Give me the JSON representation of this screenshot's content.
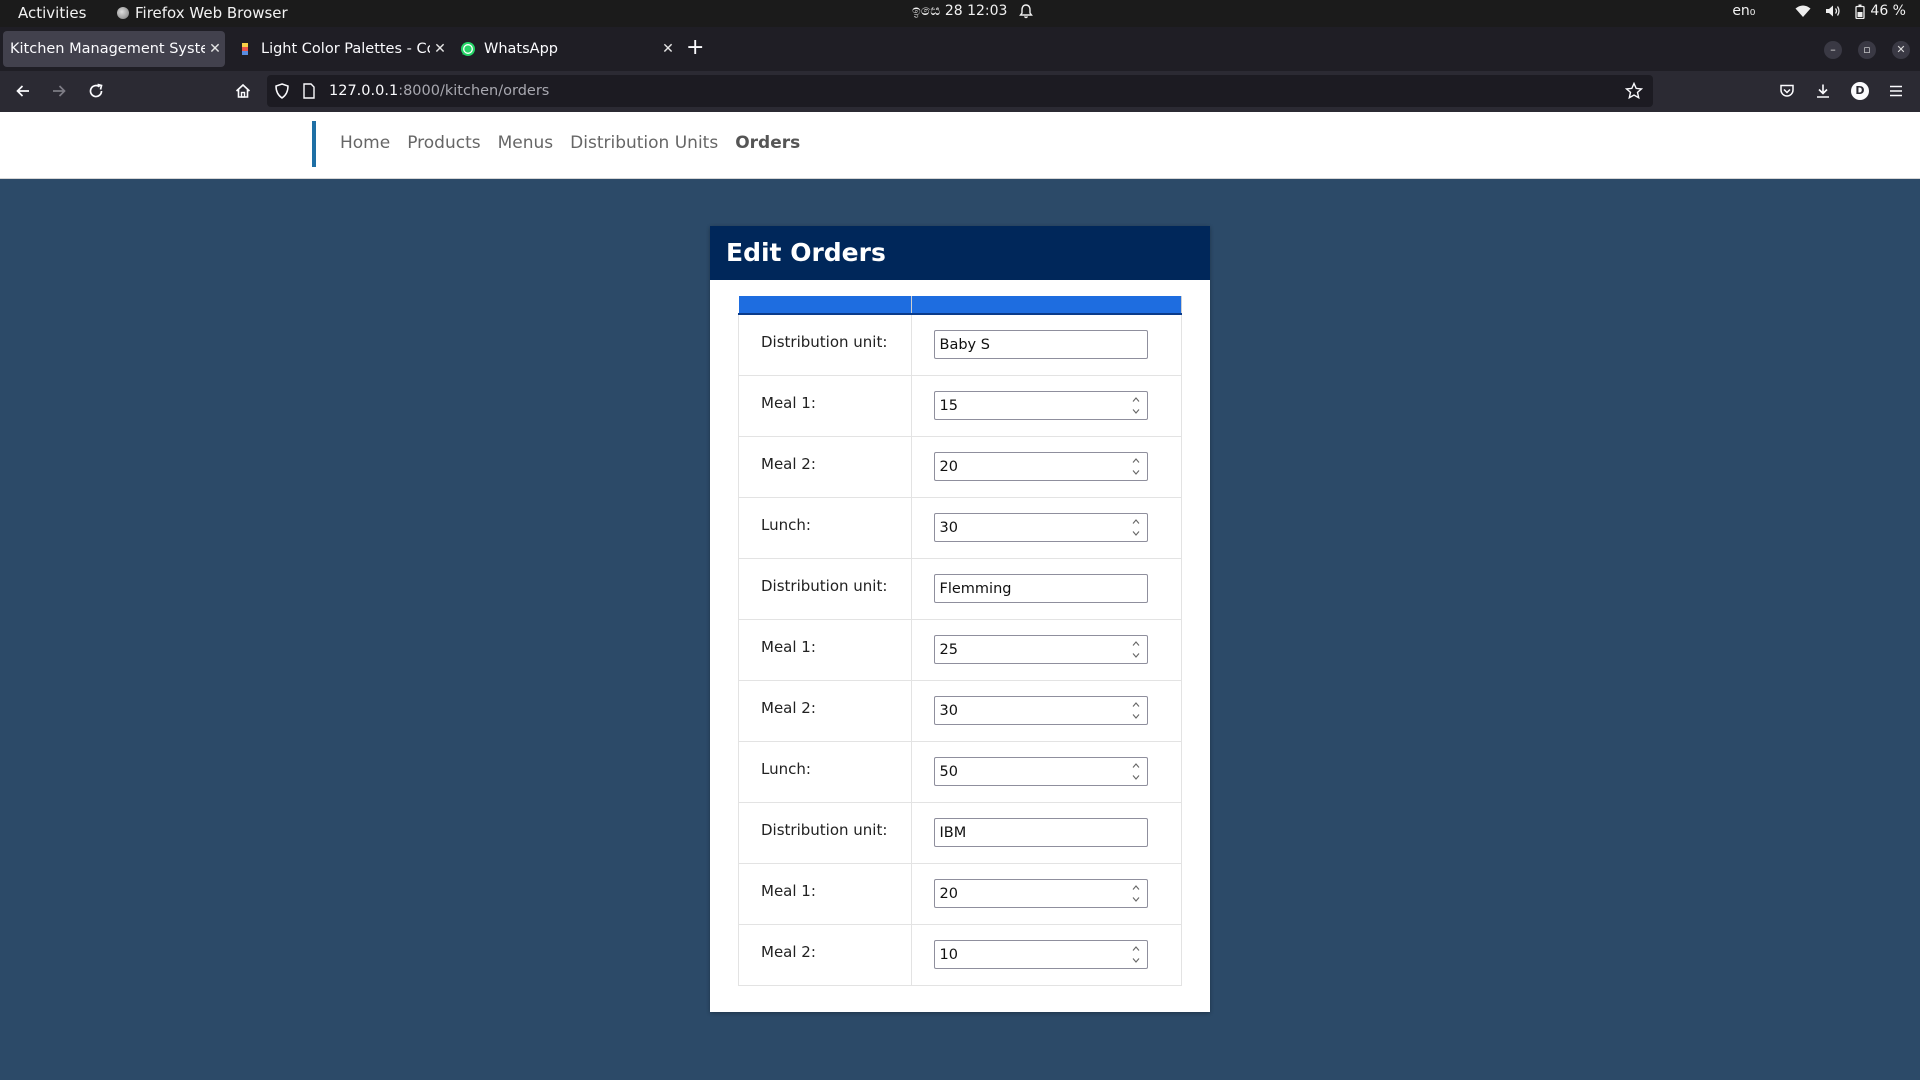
{
  "system_bar": {
    "activities": "Activities",
    "app_name": "Firefox Web Browser",
    "clock": "ඉසෙ 28  12:03",
    "language": "en₀",
    "battery": "46 %"
  },
  "browser": {
    "tabs": [
      {
        "title": "Kitchen Management System",
        "active": true
      },
      {
        "title": "Light Color Palettes - Col",
        "active": false
      },
      {
        "title": "WhatsApp",
        "active": false
      }
    ],
    "url_host": "127.0.0.1",
    "url_path": ":8000/kitchen/orders"
  },
  "site_nav": {
    "items": [
      {
        "label": "Home",
        "active": false
      },
      {
        "label": "Products",
        "active": false
      },
      {
        "label": "Menus",
        "active": false
      },
      {
        "label": "Distribution Units",
        "active": false
      },
      {
        "label": "Orders",
        "active": true
      }
    ]
  },
  "card": {
    "title": "Edit Orders",
    "rows": [
      {
        "label": "Distribution unit:",
        "value": "Baby S",
        "type": "text"
      },
      {
        "label": "Meal 1:",
        "value": "15",
        "type": "number"
      },
      {
        "label": "Meal 2:",
        "value": "20",
        "type": "number"
      },
      {
        "label": "Lunch:",
        "value": "30",
        "type": "number"
      },
      {
        "label": "Distribution unit:",
        "value": "Flemming",
        "type": "text"
      },
      {
        "label": "Meal 1:",
        "value": "25",
        "type": "number"
      },
      {
        "label": "Meal 2:",
        "value": "30",
        "type": "number"
      },
      {
        "label": "Lunch:",
        "value": "50",
        "type": "number"
      },
      {
        "label": "Distribution unit:",
        "value": "IBM",
        "type": "text"
      },
      {
        "label": "Meal 1:",
        "value": "20",
        "type": "number"
      },
      {
        "label": "Meal 2:",
        "value": "10",
        "type": "number"
      }
    ]
  },
  "colors": {
    "page_background": "#2c4a68",
    "card_header": "#00275a",
    "table_header": "#1e6de0",
    "nav_accent": "#1e6fa5"
  }
}
